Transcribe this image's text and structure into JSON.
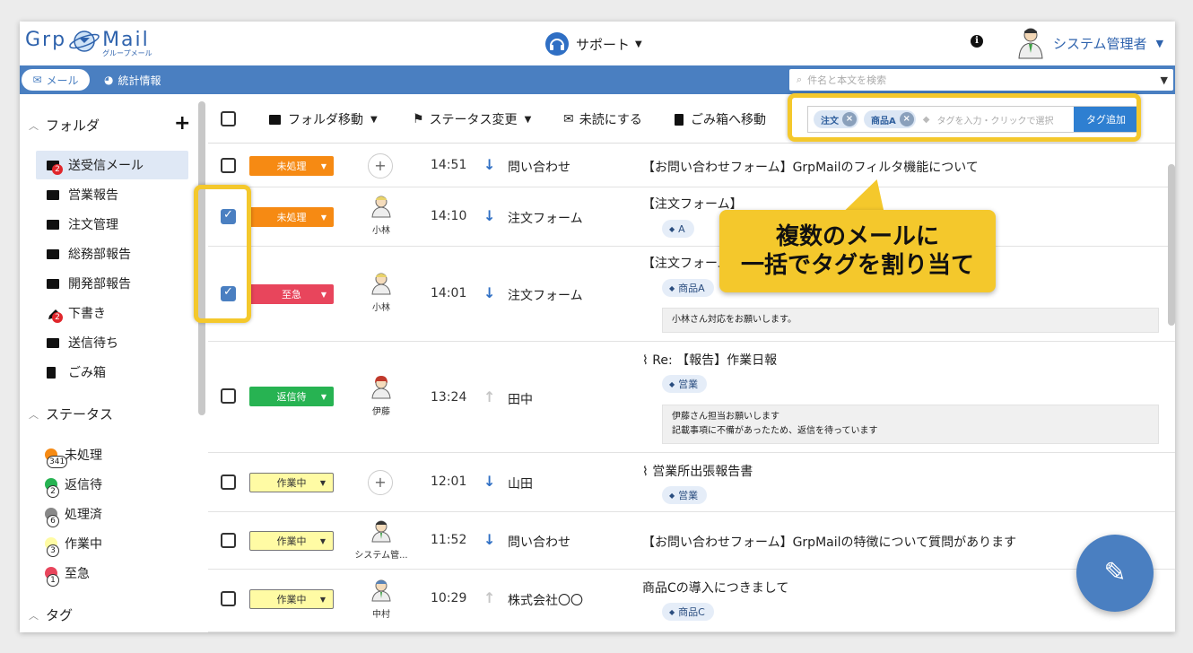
{
  "header": {
    "logo_left": "Grp",
    "logo_right": "Mail",
    "logo_sub": "グループメール",
    "support_label": "サポート",
    "user_name": "システム管理者"
  },
  "nav": {
    "mail_tab": "メール",
    "stats_tab": "統計情報",
    "search_placeholder": "件名と本文を検索"
  },
  "sidebar": {
    "folders_head": "フォルダ",
    "folders": [
      {
        "label": "送受信メール",
        "badge": "2"
      },
      {
        "label": "営業報告"
      },
      {
        "label": "注文管理"
      },
      {
        "label": "総務部報告"
      },
      {
        "label": "開発部報告"
      },
      {
        "label": "下書き",
        "badge": "2"
      },
      {
        "label": "送信待ち"
      },
      {
        "label": "ごみ箱"
      }
    ],
    "status_head": "ステータス",
    "statuses": [
      {
        "label": "未処理",
        "count": "341",
        "color": "#f68a13"
      },
      {
        "label": "返信待",
        "count": "2",
        "color": "#27b352"
      },
      {
        "label": "処理済",
        "count": "6",
        "color": "#888888"
      },
      {
        "label": "作業中",
        "count": "3",
        "color": "#fffba4"
      },
      {
        "label": "至急",
        "count": "1",
        "color": "#e8455c"
      }
    ],
    "tags_head": "タグ"
  },
  "toolbar": {
    "move_folder": "フォルダ移動",
    "change_status": "ステータス変更",
    "mark_unread": "未読にする",
    "to_trash": "ごみ箱へ移動",
    "tag_chip_1": "注文",
    "tag_chip_2": "商品A",
    "tag_input_placeholder": "タグを入力・クリックで選択",
    "tag_add": "タグ追加"
  },
  "callout": {
    "line1": "複数のメールに",
    "line2": "一括でタグを割り当て"
  },
  "rows": [
    {
      "checked": false,
      "status": "未処理",
      "assignee": "",
      "time": "14:51",
      "direction": "in",
      "from": "問い合わせ",
      "subject": "【お問い合わせフォーム】GrpMailのフィルタ機能について"
    },
    {
      "checked": true,
      "status": "未処理",
      "assignee": "小林",
      "time": "14:10",
      "direction": "in",
      "from": "注文フォーム",
      "subject": "【注文フォーム】",
      "tag": "A"
    },
    {
      "checked": true,
      "status": "至急",
      "assignee": "小林",
      "time": "14:01",
      "direction": "in",
      "from": "注文フォーム",
      "subject": "【注文フォーム】",
      "tag": "商品A",
      "memo": "小林さん対応をお願いします。"
    },
    {
      "checked": false,
      "status": "返信待",
      "assignee": "伊藤",
      "time": "13:24",
      "direction": "out",
      "from": "田中",
      "subject": "Re: 【報告】作業日報",
      "tag": "営業",
      "memo1": "伊藤さん担当お願いします",
      "memo2": "記載事項に不備があったため、返信を待っています"
    },
    {
      "checked": false,
      "status": "作業中",
      "assignee": "",
      "time": "12:01",
      "direction": "in",
      "from": "山田",
      "subject": "営業所出張報告書",
      "tag": "営業"
    },
    {
      "checked": false,
      "status": "作業中",
      "assignee": "システム管...",
      "time": "11:52",
      "direction": "in",
      "from": "問い合わせ",
      "subject": "【お問い合わせフォーム】GrpMailの特徴について質問があります"
    },
    {
      "checked": false,
      "status": "作業中",
      "assignee": "中村",
      "time": "10:29",
      "direction": "out",
      "from": "株式会社〇〇",
      "subject": "商品Cの導入につきまして",
      "tag": "商品C"
    }
  ]
}
